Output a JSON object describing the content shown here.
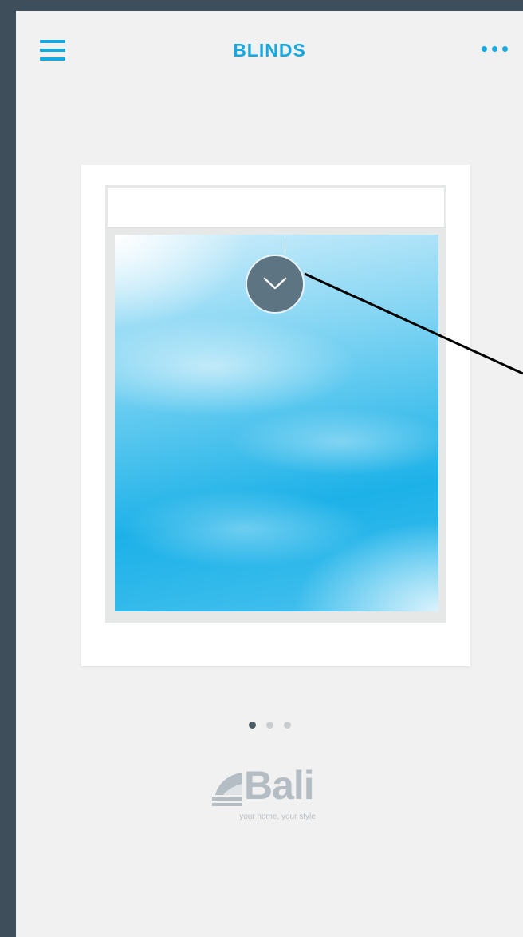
{
  "header": {
    "title": "BLINDS",
    "menu_icon": "hamburger-menu-icon",
    "more_icon": "more-dots-icon"
  },
  "blind_card": {
    "toggle_icon": "chevron-down-icon",
    "scene": "sky-window"
  },
  "pager": {
    "count": 3,
    "active_index": 0
  },
  "brand": {
    "name": "Bali",
    "tagline": "your home, your style"
  },
  "colors": {
    "accent": "#16a9e0",
    "pager_active": "#4a5b66",
    "pager_inactive": "#c9cdd0",
    "button": "#5d7482"
  }
}
